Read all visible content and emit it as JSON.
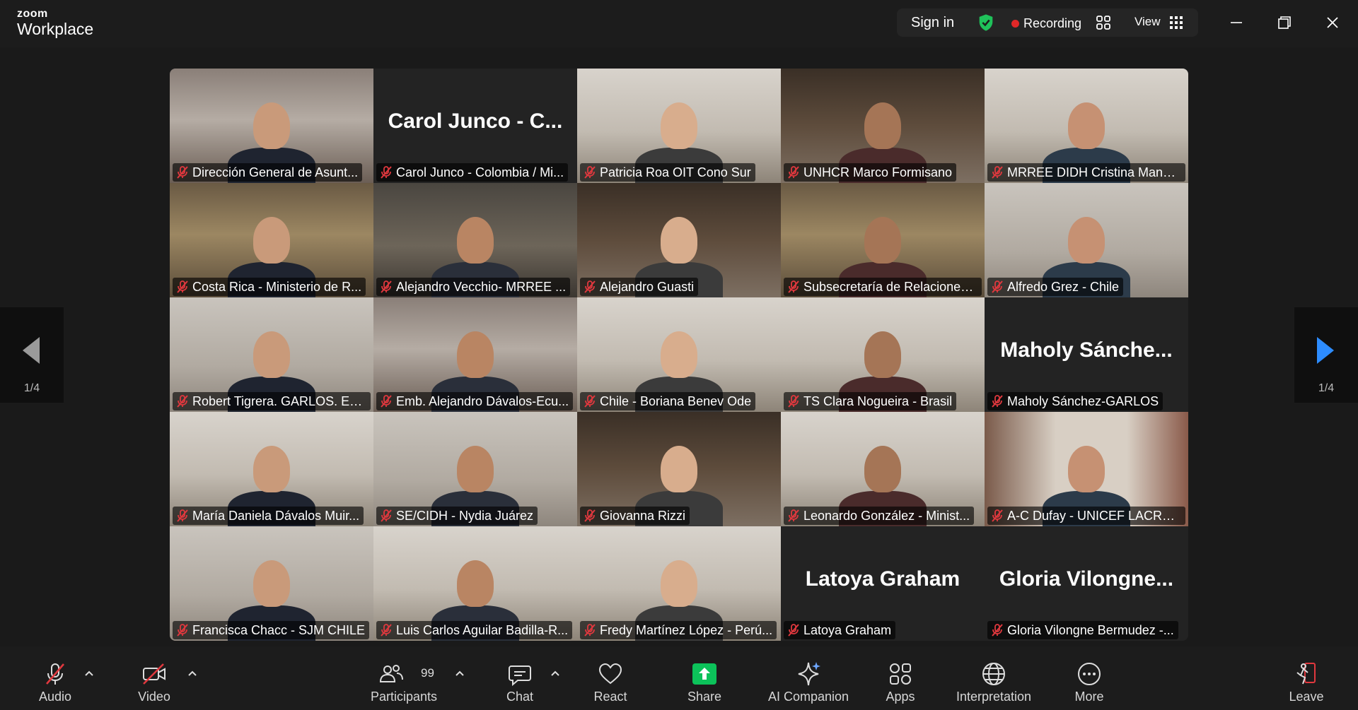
{
  "app": {
    "brand_top": "zoom",
    "brand_bottom": "Workplace"
  },
  "header": {
    "sign_in": "Sign in",
    "recording": "Recording",
    "view": "View"
  },
  "pagination": {
    "left": "1/4",
    "right": "1/4"
  },
  "participants": [
    {
      "name": "Dirección General de Asunt...",
      "display": "",
      "scene": "flags"
    },
    {
      "name": "Carol Junco - Colombia / Mi...",
      "display": "Carol Junco - C...",
      "scene": "none"
    },
    {
      "name": "Patricia Roa OIT Cono Sur",
      "display": "",
      "scene": "office-light"
    },
    {
      "name": "UNHCR Marco Formisano",
      "display": "",
      "scene": "bookshelf"
    },
    {
      "name": "MRREE DIDH Cristina Mansil...",
      "display": "",
      "scene": "office-light"
    },
    {
      "name": "Costa Rica - Ministerio de R...",
      "display": "",
      "scene": "meeting"
    },
    {
      "name": "Alejandro Vecchio- MRREE ...",
      "display": "",
      "scene": "office-dark"
    },
    {
      "name": "Alejandro Guasti",
      "display": "",
      "scene": "bookshelf"
    },
    {
      "name": "Subsecretaría de Relaciones ...",
      "display": "",
      "scene": "meeting"
    },
    {
      "name": "Alfredo Grez - Chile",
      "display": "",
      "scene": "plain"
    },
    {
      "name": "Robert Tigrera. GARLOS. Ecu...",
      "display": "",
      "scene": "plain"
    },
    {
      "name": "Emb. Alejandro Dávalos-Ecu...",
      "display": "",
      "scene": "flags"
    },
    {
      "name": "Chile - Boriana Benev Ode",
      "display": "",
      "scene": "office-light",
      "speaking": true
    },
    {
      "name": "TS Clara Nogueira - Brasil",
      "display": "",
      "scene": "office-light"
    },
    {
      "name": "Maholy Sánchez-GARLOS",
      "display": "Maholy Sánche...",
      "scene": "none"
    },
    {
      "name": "María Daniela Dávalos Muir...",
      "display": "",
      "scene": "office-light"
    },
    {
      "name": "SE/CIDH - Nydia Juárez",
      "display": "",
      "scene": "plain"
    },
    {
      "name": "Giovanna Rizzi",
      "display": "",
      "scene": "bookshelf"
    },
    {
      "name": "Leonardo González - Minist...",
      "display": "",
      "scene": "office-light"
    },
    {
      "name": "A-C Dufay - UNICEF LACRO ...",
      "display": "",
      "scene": "posters"
    },
    {
      "name": "Francisca Chacc - SJM CHILE",
      "display": "",
      "scene": "plain"
    },
    {
      "name": "Luis Carlos Aguilar Badilla-R...",
      "display": "",
      "scene": "office-light"
    },
    {
      "name": "Fredy Martínez López - Perú...",
      "display": "",
      "scene": "office-light"
    },
    {
      "name": "Latoya Graham",
      "display": "Latoya Graham",
      "scene": "none",
      "unmuted": true
    },
    {
      "name": "Gloria Vilongne Bermudez -...",
      "display": "Gloria Vilongne...",
      "scene": "none"
    }
  ],
  "toolbar": {
    "audio": "Audio",
    "video": "Video",
    "participants": "Participants",
    "participant_count": "99",
    "chat": "Chat",
    "react": "React",
    "share": "Share",
    "ai_companion": "AI Companion",
    "apps": "Apps",
    "interpretation": "Interpretation",
    "more": "More",
    "leave": "Leave"
  },
  "colors": {
    "share_green": "#0cc25a",
    "speaking_border": "#23d175",
    "mute_red": "#e0383e",
    "arrow_blue": "#2d8cff"
  }
}
